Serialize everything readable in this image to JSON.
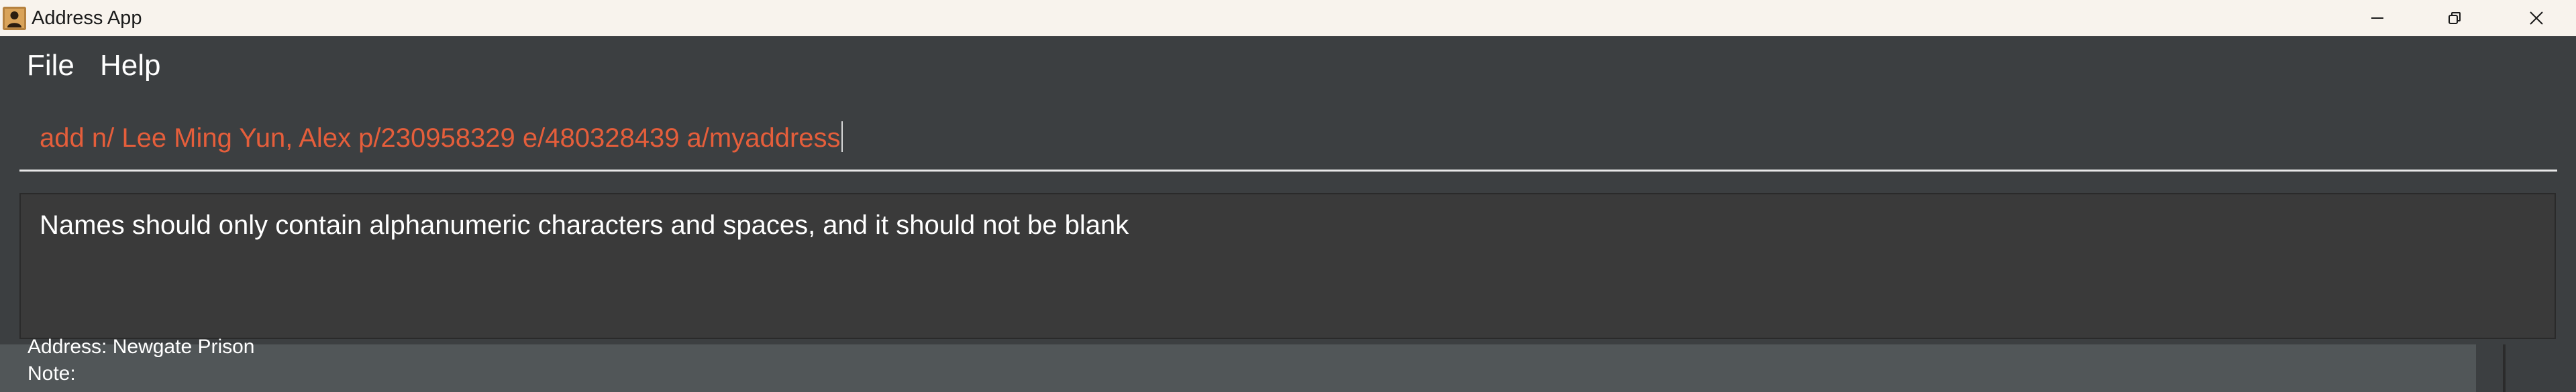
{
  "window": {
    "title": "Address App",
    "icon": "address-book-icon",
    "controls": {
      "minimize_icon": "minimize-icon",
      "restore_icon": "restore-icon",
      "close_icon": "close-icon"
    }
  },
  "menu": {
    "items": [
      {
        "label": "File"
      },
      {
        "label": "Help"
      }
    ]
  },
  "command_box": {
    "value": "add n/ Lee Ming Yun, Alex p/230958329 e/480328439 a/myaddress",
    "text_color": "#e55e3b"
  },
  "result_display": {
    "message": "Names should only contain alphanumeric characters and spaces, and it should not be blank"
  },
  "person_list": {
    "visible_lines": [
      {
        "text": "Address: Newgate Prison"
      },
      {
        "text": "Note:"
      }
    ]
  },
  "colors": {
    "titlebar_bg": "#f8f3ed",
    "app_bg": "#3c3f41",
    "error_text": "#e55e3b"
  }
}
